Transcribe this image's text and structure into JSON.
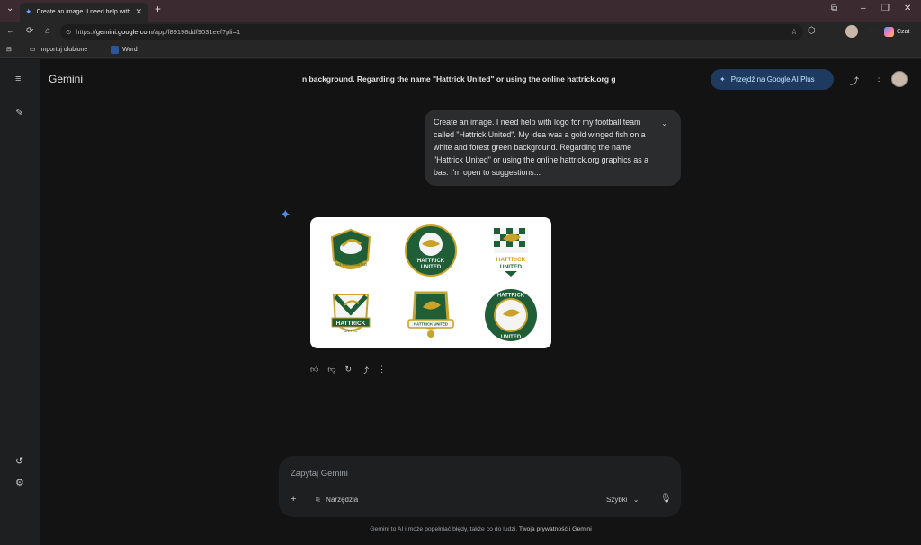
{
  "browser": {
    "tab_title": "Create an image. I need help with",
    "url_prefix": "https://",
    "url_host": "gemini.google.com",
    "url_path": "/app/f89198ddf9031eef?pli=1",
    "copilot_label": "Czat",
    "bookmarks": [
      {
        "label": "Importuj ulubione"
      },
      {
        "label": "Word"
      }
    ]
  },
  "app": {
    "brand": "Gemini",
    "conversation_title": "n background. Regarding the name \"Hattrick United\" or using the online hattrick.org g",
    "upgrade_label": "Przejdź na Google AI Plus",
    "accent": "#4c8df6"
  },
  "user_message": "Create an image. I need help with logo for my football team called \"Hattrick United\". My idea was a gold winged fish on a white and forest green background. Regarding the name \"Hattrick United\" or using the online hattrick.org graphics as a bas. I'm open to suggestions...",
  "logos": [
    {
      "line1": "HATTRICK UNITED",
      "line2": ""
    },
    {
      "line1": "HATTRICK",
      "line2": "UNITED"
    },
    {
      "line1": "HATTRICK",
      "line2": "UNITED"
    },
    {
      "line1": "HATTRICK",
      "line2": "UNITED"
    },
    {
      "line1": "HATTRICK UNITED",
      "line2": ""
    },
    {
      "line1": "HATTRICK",
      "line2": "UNITED"
    }
  ],
  "input": {
    "placeholder": "Zapytaj Gemini",
    "tools_label": "Narzędzia",
    "model_label": "Szybki"
  },
  "footer": {
    "text": "Gemini to AI i może popełniać błędy, także co do ludzi. ",
    "link": "Twoja prywatność i Gemini"
  },
  "colors": {
    "forest_green": "#1f5e37",
    "gold": "#c9a227"
  }
}
